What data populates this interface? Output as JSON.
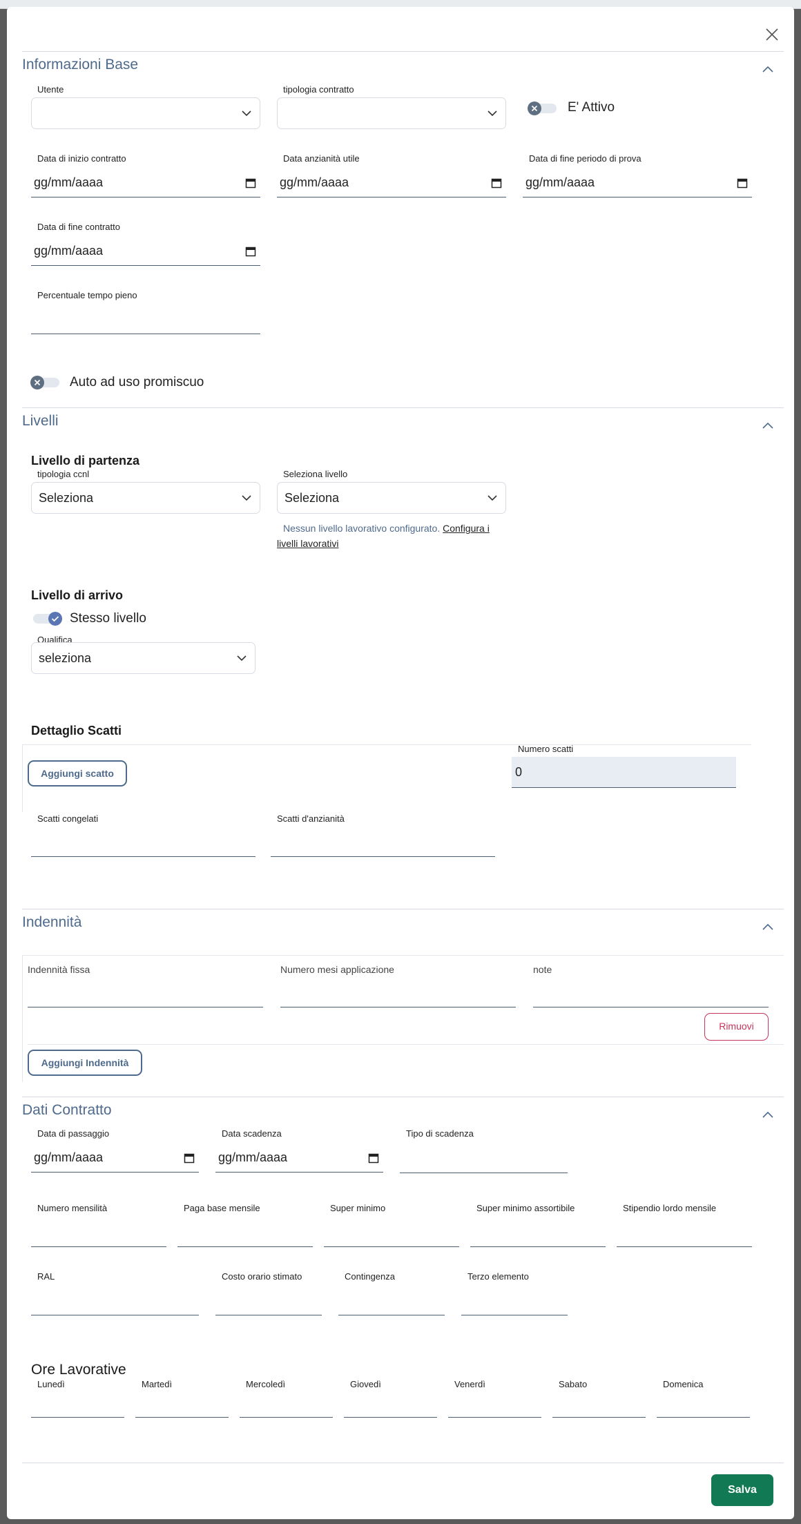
{
  "close_icon": "close-icon",
  "sections": {
    "info_base": "Informazioni Base",
    "livelli": "Livelli",
    "indennita": "Indennità",
    "dati_contratto": "Dati Contratto"
  },
  "info_base": {
    "utente_label": "Utente",
    "utente_value": "",
    "tipologia_contratto_label": "tipologia contratto",
    "tipologia_contratto_value": "",
    "attivo_label": "E' Attivo",
    "data_inizio_label": "Data di inizio contratto",
    "data_anzianita_label": "Data anzianità utile",
    "data_fine_prova_label": "Data di fine periodo di prova",
    "data_fine_contratto_label": "Data di fine contratto",
    "date_placeholder": "gg/mm/aaaa",
    "percentuale_label": "Percentuale tempo pieno",
    "auto_label": "Auto ad uso promiscuo"
  },
  "livelli": {
    "partenza_title": "Livello di partenza",
    "ccnl_label": "tipologia ccnl",
    "ccnl_value": "Seleziona",
    "seleziona_livello_label": "Seleziona livello",
    "seleziona_livello_value": "Seleziona",
    "info_text": "Nessun livello lavorativo configurato.",
    "info_link_1": "Configura i",
    "info_link_2": "livelli lavorativi",
    "arrivo_title": "Livello di arrivo",
    "stesso_livello_label": "Stesso livello",
    "qualifica_label": "Qualifica",
    "qualifica_value": "seleziona",
    "scatti_title": "Dettaglio Scatti",
    "aggiungi_scatto": "Aggiungi scatto",
    "numero_scatti_label": "Numero scatti",
    "numero_scatti_value": "0",
    "scatti_congelati_label": "Scatti congelati",
    "scatti_anzianita_label": "Scatti d'anzianità"
  },
  "indennita": {
    "fissa_label": "Indennità fissa",
    "mesi_label": "Numero mesi applicazione",
    "note_label": "note",
    "rimuovi": "Rimuovi",
    "aggiungi": "Aggiungi Indennità"
  },
  "dati_contratto": {
    "data_passaggio_label": "Data di passaggio",
    "data_scadenza_label": "Data scadenza",
    "tipo_scadenza_label": "Tipo di scadenza",
    "date_placeholder": "gg/mm/aaaa",
    "row2": [
      "Numero mensilità",
      "Paga base mensile",
      "Super minimo",
      "Super minimo assortibile",
      "Stipendio lordo mensile"
    ],
    "row3": [
      "RAL",
      "Costo orario stimato",
      "Contingenza",
      "Terzo elemento"
    ],
    "ore_title": "Ore Lavorative",
    "giorni": [
      "Lunedì",
      "Martedì",
      "Mercoledì",
      "Giovedì",
      "Venerdì",
      "Sabato",
      "Domenica"
    ]
  },
  "save_label": "Salva",
  "colors": {
    "accent": "#4e6a8c",
    "save": "#117a55",
    "danger": "#c8355a",
    "toggle_on": "#5b76b3"
  }
}
